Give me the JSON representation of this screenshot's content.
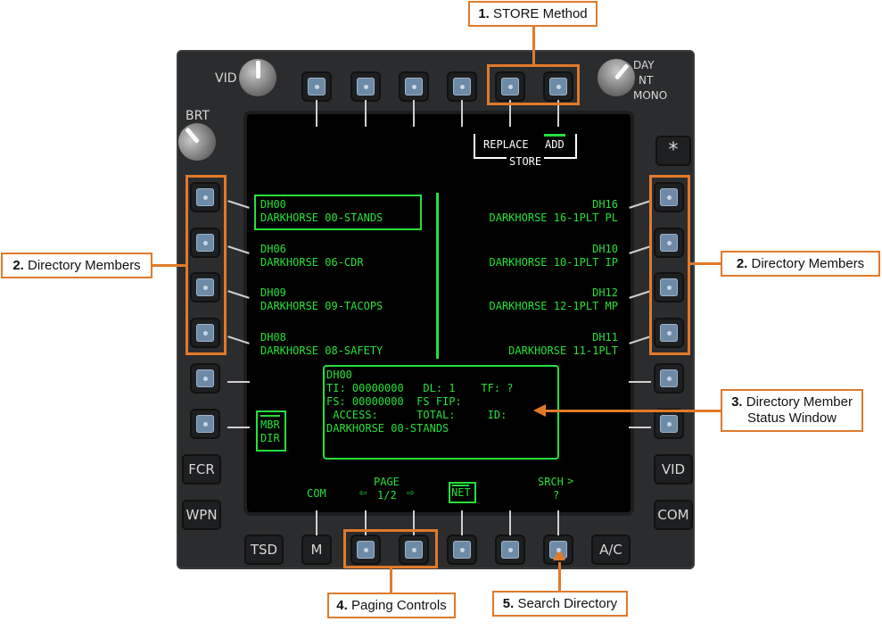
{
  "display": {
    "knobs": {
      "vid": "VID",
      "brt": "BRT",
      "day": "DAY",
      "nt": "NT",
      "mono": "MONO"
    },
    "side_buttons": {
      "asterisk": "*",
      "fcr": "FCR",
      "wpn": "WPN",
      "vid": "VID",
      "com": "COM",
      "tsd": "TSD",
      "m": "M",
      "ac": "A/C"
    },
    "store": {
      "replace": "REPLACE",
      "add": "ADD",
      "label": "STORE"
    },
    "left_members": [
      {
        "id": "DH00",
        "name": "DARKHORSE 00-STANDS"
      },
      {
        "id": "DH06",
        "name": "DARKHORSE 06-CDR"
      },
      {
        "id": "DH09",
        "name": "DARKHORSE 09-TACOPS"
      },
      {
        "id": "DH08",
        "name": "DARKHORSE 08-SAFETY"
      }
    ],
    "right_members": [
      {
        "id": "DH16",
        "name": "DARKHORSE 16-1PLT PL"
      },
      {
        "id": "DH10",
        "name": "DARKHORSE 10-1PLT IP"
      },
      {
        "id": "DH12",
        "name": "DARKHORSE 12-1PLT MP"
      },
      {
        "id": "DH11",
        "name": "DARKHORSE 11-1PLT"
      }
    ],
    "status": {
      "line1": "DH00",
      "line2": "TI: 00000000   DL: 1    TF: ?",
      "line3": "FS: 00000000  FS FIP:",
      "line4": " ACCESS:      TOTAL:     ID:",
      "line5": "DARKHORSE 00-STANDS"
    },
    "mbr_dir": {
      "line1": "MBR",
      "line2": "DIR"
    },
    "bottom": {
      "com": "COM",
      "page_label": "PAGE",
      "page_value": "1/2",
      "arrow_left": "⇦",
      "arrow_right": "⇨",
      "net": "NET",
      "srch": "SRCH",
      "srch_value": "?"
    }
  },
  "callouts": [
    {
      "num": "1.",
      "text": "STORE Method"
    },
    {
      "num": "2.",
      "text": "Directory Members"
    },
    {
      "num": "2.",
      "text": "Directory Members"
    },
    {
      "num": "3.",
      "text": "Directory Member",
      "text2": "Status Window"
    },
    {
      "num": "4.",
      "text": "Paging Controls"
    },
    {
      "num": "5.",
      "text": "Search Directory"
    }
  ],
  "colors": {
    "symbology": "#26e03a",
    "callout": "#e07a2a",
    "button": "#6d8aa6"
  }
}
